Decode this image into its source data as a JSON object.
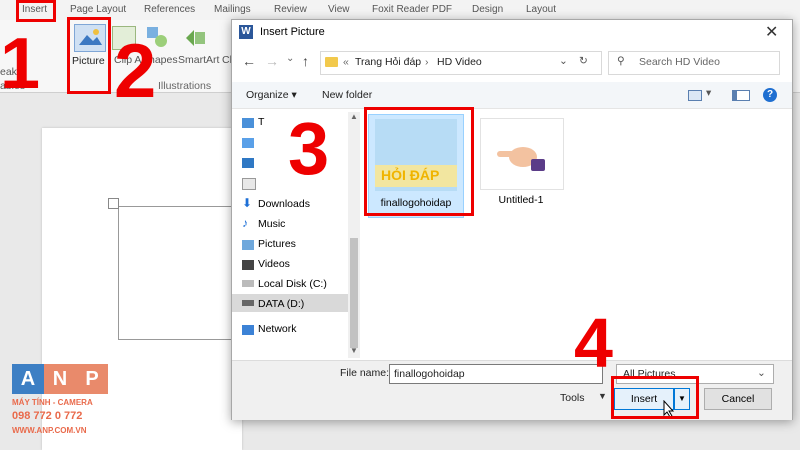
{
  "ribbon": {
    "tabs": [
      "Insert",
      "Page Layout",
      "References",
      "Mailings",
      "Review",
      "View",
      "Foxit Reader PDF",
      "Design",
      "Layout"
    ],
    "picture_label": "Picture",
    "clip_label": "Clip Art",
    "shapes_label": "Shapes",
    "smartart_label": "SmartArt",
    "chart_label": "Ch",
    "group_illustrations": "Illustrations",
    "left_labels": [
      "eak",
      "ables"
    ]
  },
  "annotations": {
    "n1": "1",
    "n2": "2",
    "n3": "3",
    "n4": "4"
  },
  "dialog": {
    "title": "Insert Picture",
    "title_icon": "W",
    "close": "✕",
    "breadcrumb": [
      "«",
      "Trang Hỏi đáp",
      "›",
      "HD Video"
    ],
    "search_placeholder": "Search HD Video",
    "organize": "Organize ▾",
    "new_folder": "New folder",
    "nav_items": [
      "T",
      "Downloads",
      "Music",
      "Pictures",
      "Videos",
      "Local Disk (C:)",
      "DATA (D:)",
      "Network"
    ],
    "files": [
      {
        "name": "finallogohoidap",
        "caption": "HỎI ĐÁP"
      },
      {
        "name": "Untitled-1"
      }
    ],
    "file_name_label": "File name:",
    "file_name_value": "finallogohoidap",
    "filter": "All Pictures",
    "tools": "Tools",
    "insert": "Insert",
    "cancel": "Cancel"
  },
  "logo": {
    "letters": [
      "A",
      "N",
      "P"
    ],
    "line1": "MÁY TÍNH - CAMERA",
    "phone": "098 772 0 772",
    "site": "WWW.ANP.COM.VN"
  },
  "colors": {
    "accent_red": "#e00000",
    "word_blue": "#2b579a",
    "selection": "#cce8ff"
  }
}
